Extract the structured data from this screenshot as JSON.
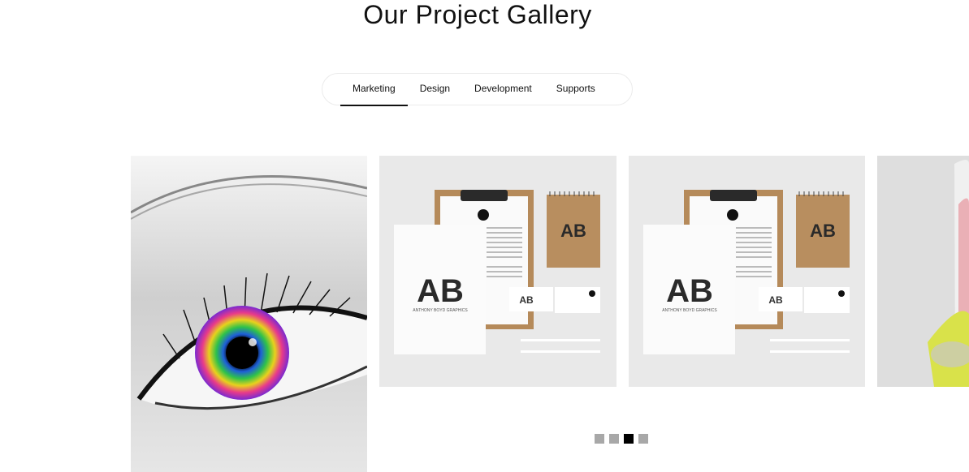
{
  "section": {
    "title": "Our Project Gallery"
  },
  "tabs": [
    {
      "label": "Marketing",
      "active": true
    },
    {
      "label": "Design",
      "active": false
    },
    {
      "label": "Development",
      "active": false
    },
    {
      "label": "Supports",
      "active": false
    }
  ],
  "gallery": {
    "slides": [
      {
        "name": "eye-photo"
      },
      {
        "name": "stationery-mockup",
        "logo": "AB",
        "brand": "ANTHONY BOYD GRAPHICS",
        "card_name": "ANTHONY BOYD"
      },
      {
        "name": "stationery-mockup",
        "logo": "AB",
        "brand": "ANTHONY BOYD GRAPHICS",
        "card_name": "ANTHONY BOYD"
      },
      {
        "name": "can-mockup"
      }
    ],
    "pagination": {
      "count": 4,
      "active_index": 2
    }
  },
  "colors": {
    "accent": "#000000",
    "dot_inactive": "#a8a8a8",
    "tab_border": "#ebebeb"
  }
}
